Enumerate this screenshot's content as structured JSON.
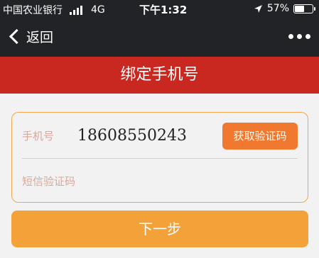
{
  "status_bar": {
    "carrier": "中国农业银行",
    "network": "4G",
    "time": "下午1:32",
    "battery": "57%",
    "battery_level": 0.57
  },
  "nav": {
    "back_label": "返回",
    "more_icon": "more-dots-icon"
  },
  "page": {
    "title": "绑定手机号"
  },
  "form": {
    "phone_label": "手机号",
    "phone_value": "18608550243",
    "get_code_label": "获取验证码",
    "sms_placeholder": "短信验证码"
  },
  "actions": {
    "next_label": "下一步"
  },
  "colors": {
    "header_bg": "#222327",
    "title_bar_bg": "#c8281f",
    "accent_orange": "#f0782f",
    "next_button": "#f3a23a"
  }
}
